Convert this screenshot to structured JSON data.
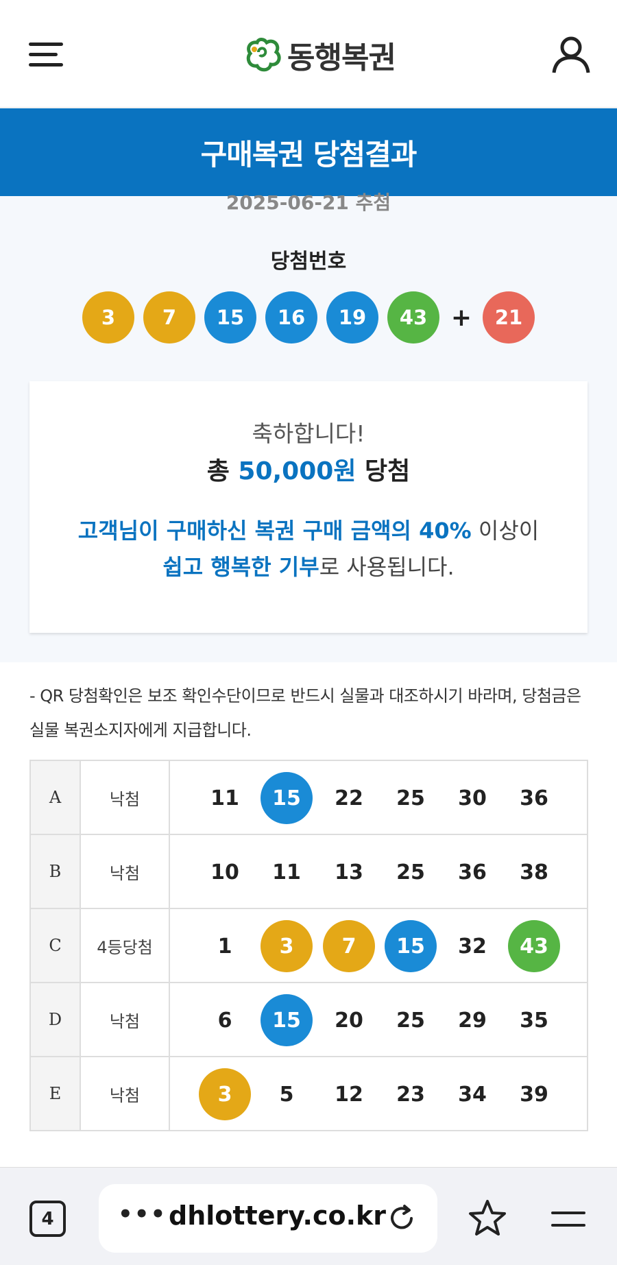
{
  "header": {
    "logo_text": "동행복권"
  },
  "page_title": "구매복권 당첨결과",
  "draw": {
    "date": "2025-06-21 추첨",
    "label": "당첨번호",
    "plus": "+",
    "numbers": [
      {
        "value": "3",
        "color": "#e4a817"
      },
      {
        "value": "7",
        "color": "#e4a817"
      },
      {
        "value": "15",
        "color": "#1a8bd6"
      },
      {
        "value": "16",
        "color": "#1a8bd6"
      },
      {
        "value": "19",
        "color": "#1a8bd6"
      },
      {
        "value": "43",
        "color": "#56b544"
      }
    ],
    "bonus": {
      "value": "21",
      "color": "#e8685a"
    }
  },
  "prize": {
    "congrats": "축하합니다!",
    "total_prefix": "총",
    "total_amount": "50,000원",
    "total_suffix": "당첨",
    "donate_line1_hl": "고객님이 구매하신 복권 구매 금액의 40%",
    "donate_line1_rest": " 이상이",
    "donate_line2_hl": "쉽고 행복한 기부",
    "donate_line2_rest": "로 사용됩니다."
  },
  "notice": "- QR 당첨확인은 보조 확인수단이므로 반드시 실물과 대조하시기 바라며, 당첨금은 실물 복권소지자에게 지급합니다.",
  "tickets": [
    {
      "slot": "A",
      "rank": "낙첨",
      "numbers": [
        {
          "value": "11",
          "color": ""
        },
        {
          "value": "15",
          "color": "#1a8bd6"
        },
        {
          "value": "22",
          "color": ""
        },
        {
          "value": "25",
          "color": ""
        },
        {
          "value": "30",
          "color": ""
        },
        {
          "value": "36",
          "color": ""
        }
      ]
    },
    {
      "slot": "B",
      "rank": "낙첨",
      "numbers": [
        {
          "value": "10",
          "color": ""
        },
        {
          "value": "11",
          "color": ""
        },
        {
          "value": "13",
          "color": ""
        },
        {
          "value": "25",
          "color": ""
        },
        {
          "value": "36",
          "color": ""
        },
        {
          "value": "38",
          "color": ""
        }
      ]
    },
    {
      "slot": "C",
      "rank": "4등당첨",
      "numbers": [
        {
          "value": "1",
          "color": ""
        },
        {
          "value": "3",
          "color": "#e4a817"
        },
        {
          "value": "7",
          "color": "#e4a817"
        },
        {
          "value": "15",
          "color": "#1a8bd6"
        },
        {
          "value": "32",
          "color": ""
        },
        {
          "value": "43",
          "color": "#56b544"
        }
      ]
    },
    {
      "slot": "D",
      "rank": "낙첨",
      "numbers": [
        {
          "value": "6",
          "color": ""
        },
        {
          "value": "15",
          "color": "#1a8bd6"
        },
        {
          "value": "20",
          "color": ""
        },
        {
          "value": "25",
          "color": ""
        },
        {
          "value": "29",
          "color": ""
        },
        {
          "value": "35",
          "color": ""
        }
      ]
    },
    {
      "slot": "E",
      "rank": "낙첨",
      "numbers": [
        {
          "value": "3",
          "color": "#e4a817"
        },
        {
          "value": "5",
          "color": ""
        },
        {
          "value": "12",
          "color": ""
        },
        {
          "value": "23",
          "color": ""
        },
        {
          "value": "34",
          "color": ""
        },
        {
          "value": "39",
          "color": ""
        }
      ]
    }
  ],
  "browser": {
    "tab_count": "4",
    "dots": "•••",
    "url": "dhlottery.co.kr"
  },
  "icons": {
    "menu": "hamburger-icon",
    "user": "user-icon",
    "reload": "reload-icon",
    "bookmark": "star-icon",
    "browser_menu": "menu-icon"
  },
  "colors": {
    "brand_blue": "#0a73c0"
  }
}
